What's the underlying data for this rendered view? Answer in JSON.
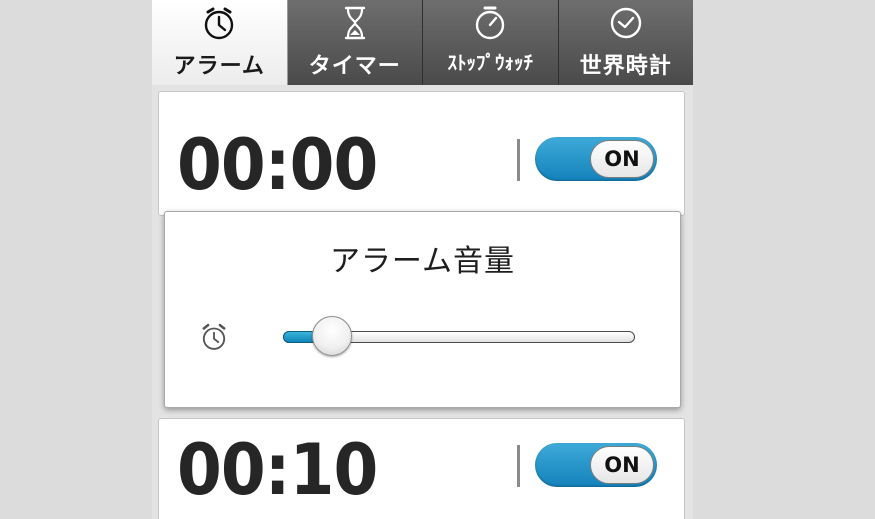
{
  "tabs": [
    {
      "label": "アラーム",
      "icon": "alarm-clock-icon",
      "active": true
    },
    {
      "label": "タイマー",
      "icon": "hourglass-icon",
      "active": false
    },
    {
      "label": "ｽﾄｯﾌﾟｳｫｯﾁ",
      "icon": "stopwatch-icon",
      "active": false
    },
    {
      "label": "世界時計",
      "icon": "clock-icon",
      "active": false
    }
  ],
  "alarms": [
    {
      "time": "00:00",
      "toggle_label": "ON"
    },
    {
      "time": "00:10",
      "toggle_label": "ON"
    }
  ],
  "volume_dialog": {
    "title": "アラーム音量",
    "icon": "alarm-clock-icon",
    "level": 0.14
  },
  "colors": {
    "accent": "#1a8fc6",
    "tab_dark": "#555555"
  }
}
